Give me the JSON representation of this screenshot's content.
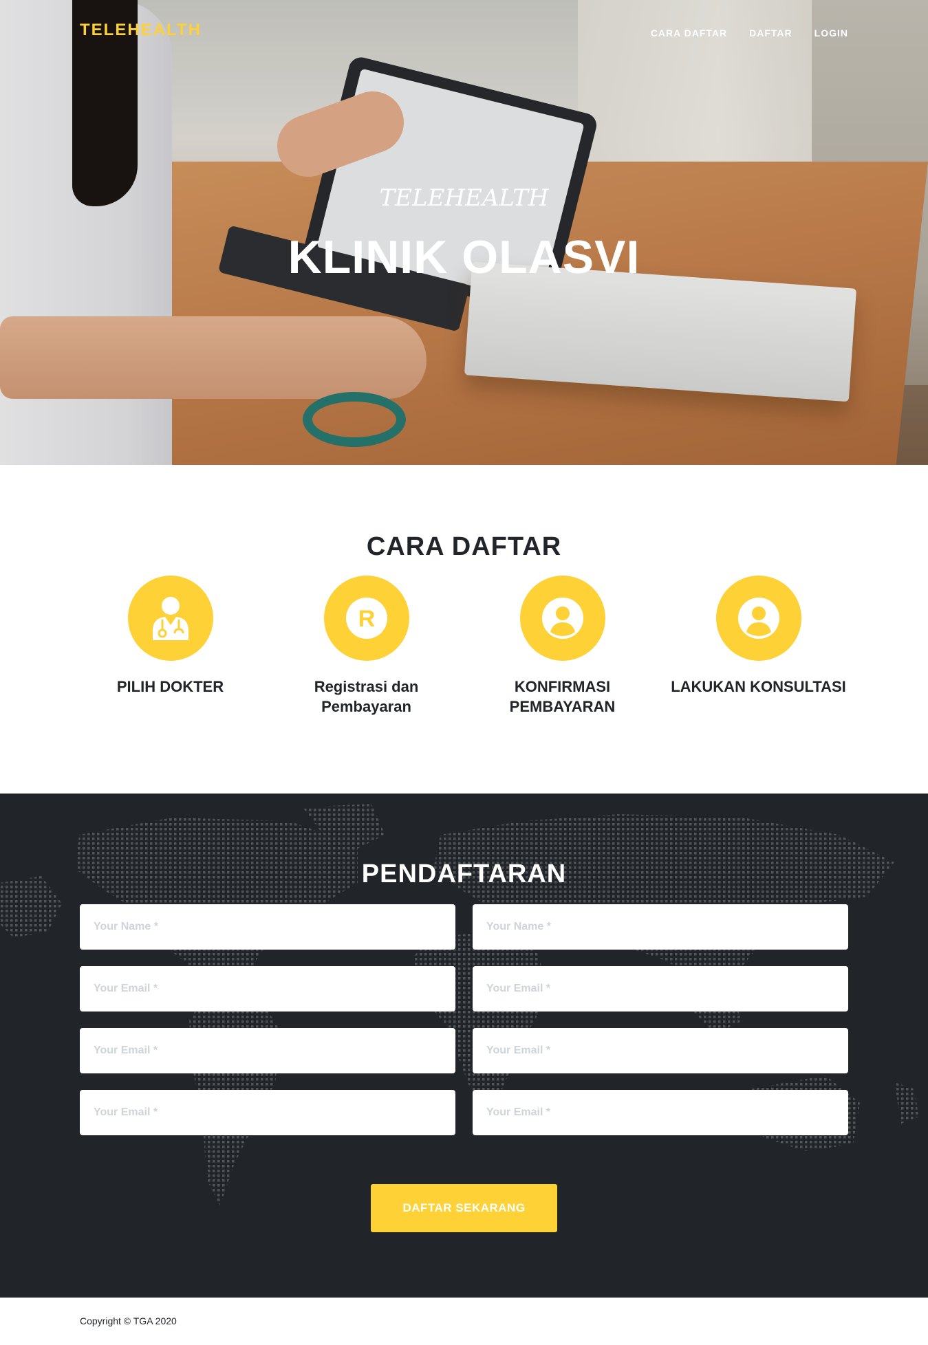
{
  "brand": "TELEHEALTH",
  "nav": [
    "CARA DAFTAR",
    "DAFTAR",
    "LOGIN"
  ],
  "hero": {
    "subtitle": "TELEHEALTH",
    "title": "KLINIK OLASVI"
  },
  "steps": {
    "heading": "CARA DAFTAR",
    "items": [
      {
        "icon": "doctor-icon",
        "label": "PILIH DOKTER"
      },
      {
        "icon": "registration-r-icon",
        "label": "Registrasi dan Pembayaran"
      },
      {
        "icon": "user-icon",
        "label": "KONFIRMASI PEMBAYARAN"
      },
      {
        "icon": "user-icon",
        "label": "LAKUKAN KONSULTASI"
      }
    ]
  },
  "form": {
    "heading": "PENDAFTARAN",
    "fields": [
      {
        "placeholder": "Your Name *"
      },
      {
        "placeholder": "Your Name *"
      },
      {
        "placeholder": "Your Email *"
      },
      {
        "placeholder": "Your Email *"
      },
      {
        "placeholder": "Your Email *"
      },
      {
        "placeholder": "Your Email *"
      },
      {
        "placeholder": "Your Email *"
      },
      {
        "placeholder": "Your Email *"
      }
    ],
    "submit_label": "DAFTAR SEKARANG"
  },
  "footer": {
    "copyright": "Copyright © TGA 2020"
  },
  "colors": {
    "accent": "#fed136",
    "dark": "#212529",
    "text": "#212529"
  }
}
